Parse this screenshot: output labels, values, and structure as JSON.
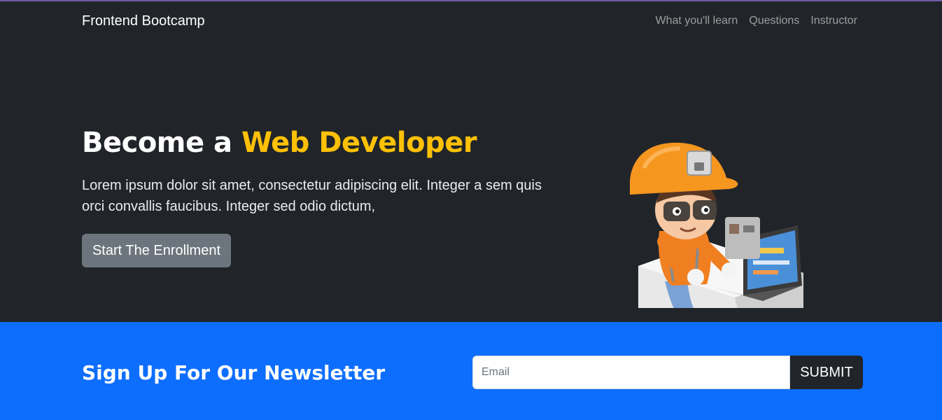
{
  "nav": {
    "brand": "Frontend Bootcamp",
    "links": [
      "What you'll learn",
      "Questions",
      "Instructor"
    ]
  },
  "hero": {
    "title_prefix": "Become a ",
    "title_highlight": "Web Developer",
    "description": "Lorem ipsum dolor sit amet, consectetur adipiscing elit. Integer a sem quis orci convallis faucibus. Integer sed odio dictum,",
    "cta_label": "Start The Enrollment",
    "illustration": "developer-character-with-laptop"
  },
  "newsletter": {
    "title": "Sign Up For Our Newsletter",
    "email_placeholder": "Email",
    "submit_label": "SUBMIT"
  },
  "colors": {
    "dark": "#212529",
    "accent": "#ffc107",
    "primary": "#0d6efd",
    "secondary": "#6c757d"
  }
}
